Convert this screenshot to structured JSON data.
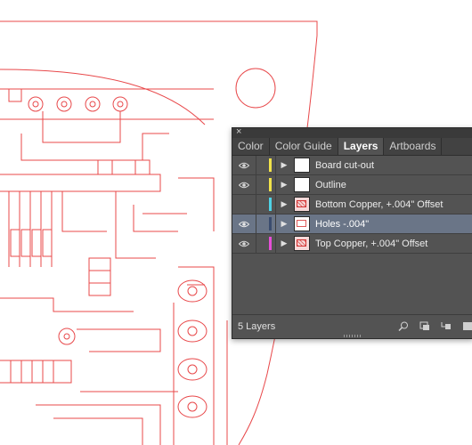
{
  "panel": {
    "close_glyph": "×",
    "tabs": [
      {
        "label": "Color",
        "active": false
      },
      {
        "label": "Color Guide",
        "active": false
      },
      {
        "label": "Layers",
        "active": true
      },
      {
        "label": "Artboards",
        "active": false
      }
    ],
    "layers": [
      {
        "name": "Board cut-out",
        "visible": true,
        "color": "#f2e34a",
        "selected": false
      },
      {
        "name": "Outline",
        "visible": true,
        "color": "#f2e34a",
        "selected": false
      },
      {
        "name": "Bottom Copper, +.004\" Offset",
        "visible": false,
        "color": "#4fd3e6",
        "selected": false
      },
      {
        "name": "Holes -.004\"",
        "visible": true,
        "color": "#3a4c6e",
        "selected": true
      },
      {
        "name": "Top Copper, +.004\" Offset",
        "visible": true,
        "color": "#e64fd8",
        "selected": false
      }
    ],
    "footer": {
      "count_label": "5 Layers",
      "icons": [
        "locate-object-icon",
        "make-clipping-mask-icon",
        "create-sublayer-icon",
        "new-layer-icon"
      ]
    }
  },
  "colors": {
    "trace": "#e8484a",
    "panel_bg": "#535353"
  }
}
